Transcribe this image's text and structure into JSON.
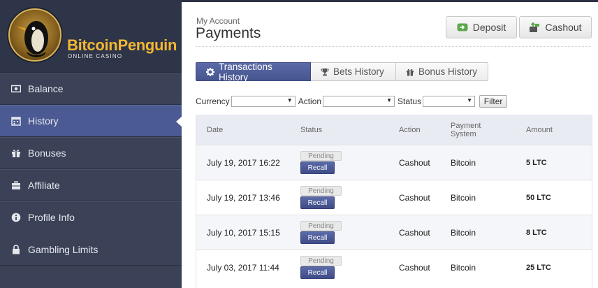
{
  "brand": {
    "name_part1": "Bitcoin",
    "name_part2": "Penguin",
    "subtitle": "ONLINE CASINO"
  },
  "sidebar": {
    "items": [
      {
        "label": "Balance",
        "icon": "money-icon"
      },
      {
        "label": "History",
        "icon": "calendar-icon",
        "active": true
      },
      {
        "label": "Bonuses",
        "icon": "gift-icon"
      },
      {
        "label": "Affiliate",
        "icon": "briefcase-icon"
      },
      {
        "label": "Profile Info",
        "icon": "info-icon"
      },
      {
        "label": "Gambling Limits",
        "icon": "lock-icon"
      }
    ]
  },
  "header": {
    "breadcrumb": "My Account",
    "title": "Payments"
  },
  "actions": {
    "deposit_label": "Deposit",
    "cashout_label": "Cashout"
  },
  "tabs": [
    {
      "label": "Transactions History",
      "icon": "gear-icon",
      "active": true
    },
    {
      "label": "Bets History",
      "icon": "trophy-icon"
    },
    {
      "label": "Bonus History",
      "icon": "gift-icon"
    }
  ],
  "filters": {
    "currency_label": "Currency",
    "action_label": "Action",
    "status_label": "Status",
    "filter_button": "Filter"
  },
  "table": {
    "headers": {
      "date": "Date",
      "status": "Status",
      "action": "Action",
      "payment_line1": "Payment",
      "payment_line2": "System",
      "amount": "Amount"
    },
    "rows": [
      {
        "date": "July 19, 2017 16:22",
        "status": "Pending",
        "recall": "Recall",
        "action": "Cashout",
        "payment": "Bitcoin",
        "amount": "5 LTC"
      },
      {
        "date": "July 19, 2017 13:46",
        "status": "Pending",
        "recall": "Recall",
        "action": "Cashout",
        "payment": "Bitcoin",
        "amount": "50 LTC"
      },
      {
        "date": "July 10, 2017 15:15",
        "status": "Pending",
        "recall": "Recall",
        "action": "Cashout",
        "payment": "Bitcoin",
        "amount": "8 LTC"
      },
      {
        "date": "July 03, 2017 11:44",
        "status": "Pending",
        "recall": "Recall",
        "action": "Cashout",
        "payment": "Bitcoin",
        "amount": "25 LTC"
      }
    ]
  },
  "colors": {
    "sidebar_bg": "#3b4257",
    "active_nav": "#4c5a93",
    "brand_gold": "#f2b632",
    "tab_active": "#4f5d98"
  }
}
